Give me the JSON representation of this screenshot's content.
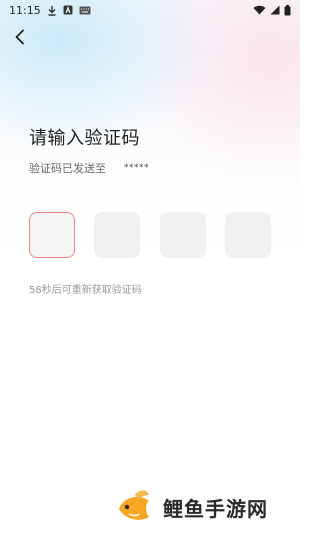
{
  "status_bar": {
    "time": "11:15",
    "left_icons": [
      "download-icon",
      "app-a-icon",
      "keyboard-icon"
    ],
    "right_icons": [
      "wifi-icon",
      "signal-icon",
      "battery-icon"
    ]
  },
  "header": {
    "back_icon": "chevron-left-icon"
  },
  "main": {
    "title": "请输入验证码",
    "sent_to_label": "验证码已发送至",
    "masked_phone": "*****",
    "code_boxes": [
      "",
      "",
      "",
      ""
    ],
    "active_box_index": 0,
    "resend_text": "58秒后可重新获取验证码"
  },
  "watermark": {
    "text": "鲤鱼手游网"
  },
  "colors": {
    "active_border": "#f0847d",
    "box_bg": "#f1f1f1",
    "title": "#222222",
    "hint": "#9a9a9a",
    "logo_orange": "#f5a623"
  }
}
